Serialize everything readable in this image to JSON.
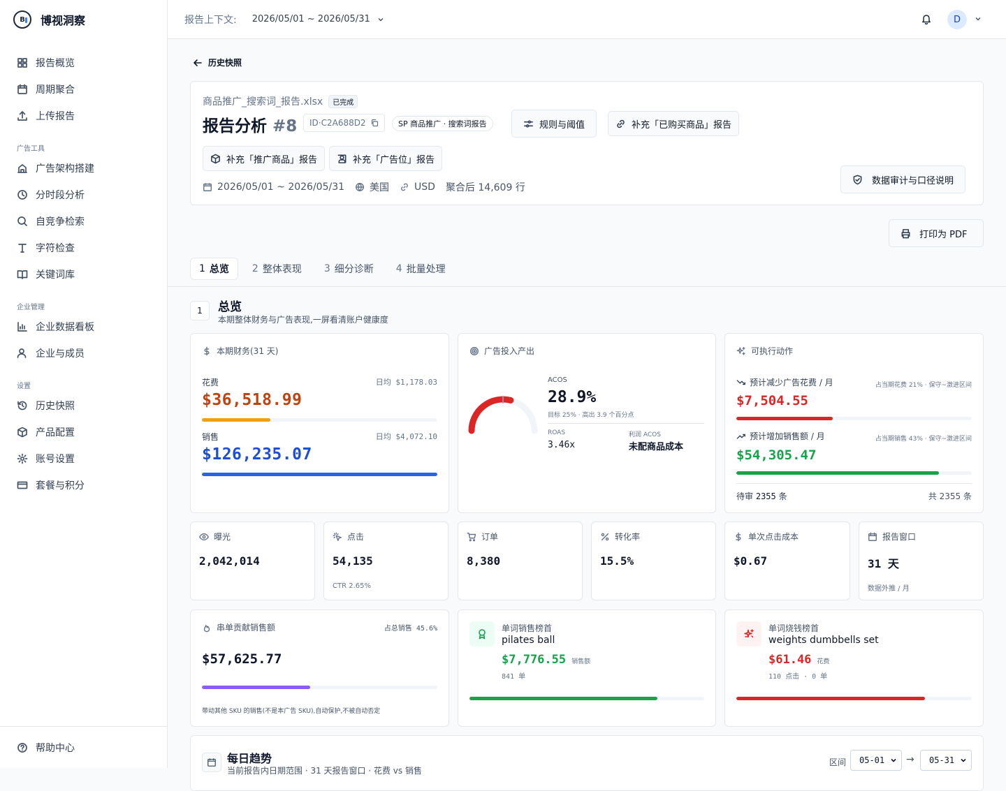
{
  "app": {
    "name": "博视洞察",
    "logo": "BI"
  },
  "nav": {
    "main": [
      {
        "label": "报告概览",
        "icon": "grid-icon"
      },
      {
        "label": "周期聚合",
        "icon": "calendar-icon"
      },
      {
        "label": "上传报告",
        "icon": "upload-icon"
      }
    ],
    "ad_tools_title": "广告工具",
    "ad_tools": [
      {
        "label": "广告架构搭建",
        "icon": "building-icon"
      },
      {
        "label": "分时段分析",
        "icon": "clock-icon"
      },
      {
        "label": "自竞争检索",
        "icon": "search-icon"
      },
      {
        "label": "字符检查",
        "icon": "type-icon"
      },
      {
        "label": "关键词库",
        "icon": "book-icon"
      }
    ],
    "enterprise_title": "企业管理",
    "enterprise": [
      {
        "label": "企业数据看板",
        "icon": "bar-chart-icon"
      },
      {
        "label": "企业与成员",
        "icon": "users-icon"
      }
    ],
    "settings_title": "设置",
    "settings": [
      {
        "label": "历史快照",
        "icon": "history-icon"
      },
      {
        "label": "产品配置",
        "icon": "box-icon"
      },
      {
        "label": "账号设置",
        "icon": "gear-icon"
      },
      {
        "label": "套餐与积分",
        "icon": "card-icon"
      }
    ],
    "help": "帮助中心"
  },
  "topbar": {
    "context_label": "报告上下文:",
    "context_value": "2026/05/01 ~ 2026/05/31",
    "avatar": "D"
  },
  "back_label": "历史快照",
  "report": {
    "file": "商品推广_搜索词_报告.xlsx",
    "status": "已完成",
    "title": "报告分析",
    "number": "#8",
    "id": "ID·C2A688D2",
    "type": "SP 商品推广 · 搜索词报告",
    "buttons": {
      "rules": "规则与阈值",
      "purchased": "补充「已购买商品」报告",
      "promoted": "补充「推广商品」报告",
      "placement": "补充「广告位」报告",
      "audit": "数据审计与口径说明",
      "print": "打印为 PDF"
    },
    "meta": {
      "dates": "2026/05/01 ~ 2026/05/31",
      "country": "美国",
      "currency": "USD",
      "rows": "聚合后 14,609 行"
    }
  },
  "tabs": [
    {
      "num": "1",
      "label": "总览"
    },
    {
      "num": "2",
      "label": "整体表现"
    },
    {
      "num": "3",
      "label": "细分诊断"
    },
    {
      "num": "4",
      "label": "批量处理"
    }
  ],
  "section": {
    "num": "1",
    "title": "总览",
    "subtitle": "本期整体财务与广告表现,一屏看清账户健康度"
  },
  "finance": {
    "title": "本期财务(31 天)",
    "spend": {
      "label": "花费",
      "daily": "日均 $1,178.03",
      "value": "$36,518.99",
      "fraction": 0.29,
      "color": "#f59e0b"
    },
    "sales": {
      "label": "销售",
      "daily": "日均 $4,072.10",
      "value": "$126,235.07",
      "fraction": 1.0,
      "color": "#2563eb"
    }
  },
  "adio": {
    "title": "广告投入产出",
    "acos_label": "ACOS",
    "acos": "28.9%",
    "acos_value": 28.9,
    "target_note": "目标 25% · 高出 3.9 个百分点",
    "roas_label": "ROAS",
    "roas": "3.46x",
    "profit_label": "利润 ACOS",
    "profit": "未配商品成本"
  },
  "actions": {
    "title": "可执行动作",
    "reduce": {
      "label": "预计减少广告花费 / 月",
      "note": "占当期花费 21% · 保守~激进区间",
      "value": "$7,504.55",
      "fraction": 0.41
    },
    "increase": {
      "label": "预计增加销售额 / 月",
      "note": "占当期销售 43% · 保守~激进区间",
      "value": "$54,305.47",
      "fraction": 0.86
    },
    "pending_label": "待审",
    "pending": "2355",
    "pending_unit": "条",
    "total": "共 2355 条"
  },
  "kpis": [
    {
      "label": "曝光",
      "icon": "eye-icon",
      "value": "2,042,014",
      "sub": ""
    },
    {
      "label": "点击",
      "icon": "click-icon",
      "value": "54,135",
      "sub": "CTR 2.65%"
    },
    {
      "label": "订单",
      "icon": "cart-icon",
      "value": "8,380",
      "sub": ""
    },
    {
      "label": "转化率",
      "icon": "percent-icon",
      "value": "15.5%",
      "sub": ""
    },
    {
      "label": "单次点击成本",
      "icon": "dollar-icon",
      "value": "$0.67",
      "sub": ""
    },
    {
      "label": "报告窗口",
      "icon": "calendar-icon",
      "value": "31 天",
      "sub": "数据外推 / 月"
    }
  ],
  "halo": {
    "title": "串单贡献销售额",
    "share": "占总销售 45.6%",
    "value": "$57,625.77",
    "fraction": 0.46,
    "note": "带动其他 SKU 的销售(不是本广告 SKU),自动保护,不被自动否定"
  },
  "top_sales": {
    "title": "单词销售榜首",
    "term": "pilates ball",
    "value": "$7,776.55",
    "value_label": "销售额",
    "sub": "841 单",
    "fraction": 0.8
  },
  "top_spend": {
    "title": "单词烧钱榜首",
    "term": "weights dumbbells set",
    "value": "$61.46",
    "value_label": "花费",
    "sub": "110 点击 · 0 单",
    "fraction": 0.8
  },
  "trend": {
    "title": "每日趋势",
    "subtitle": "当前报告内日期范围 · 31 天报告窗口 · 花费 vs 销售",
    "range_label": "区间",
    "from": "05-01",
    "to": "05-31",
    "arrow": "→"
  },
  "colors": {
    "spend": "#c2410c",
    "sales": "#1d4ed8",
    "red": "#dc2626",
    "green": "#16a34a",
    "purple": "#8b5cf6"
  }
}
